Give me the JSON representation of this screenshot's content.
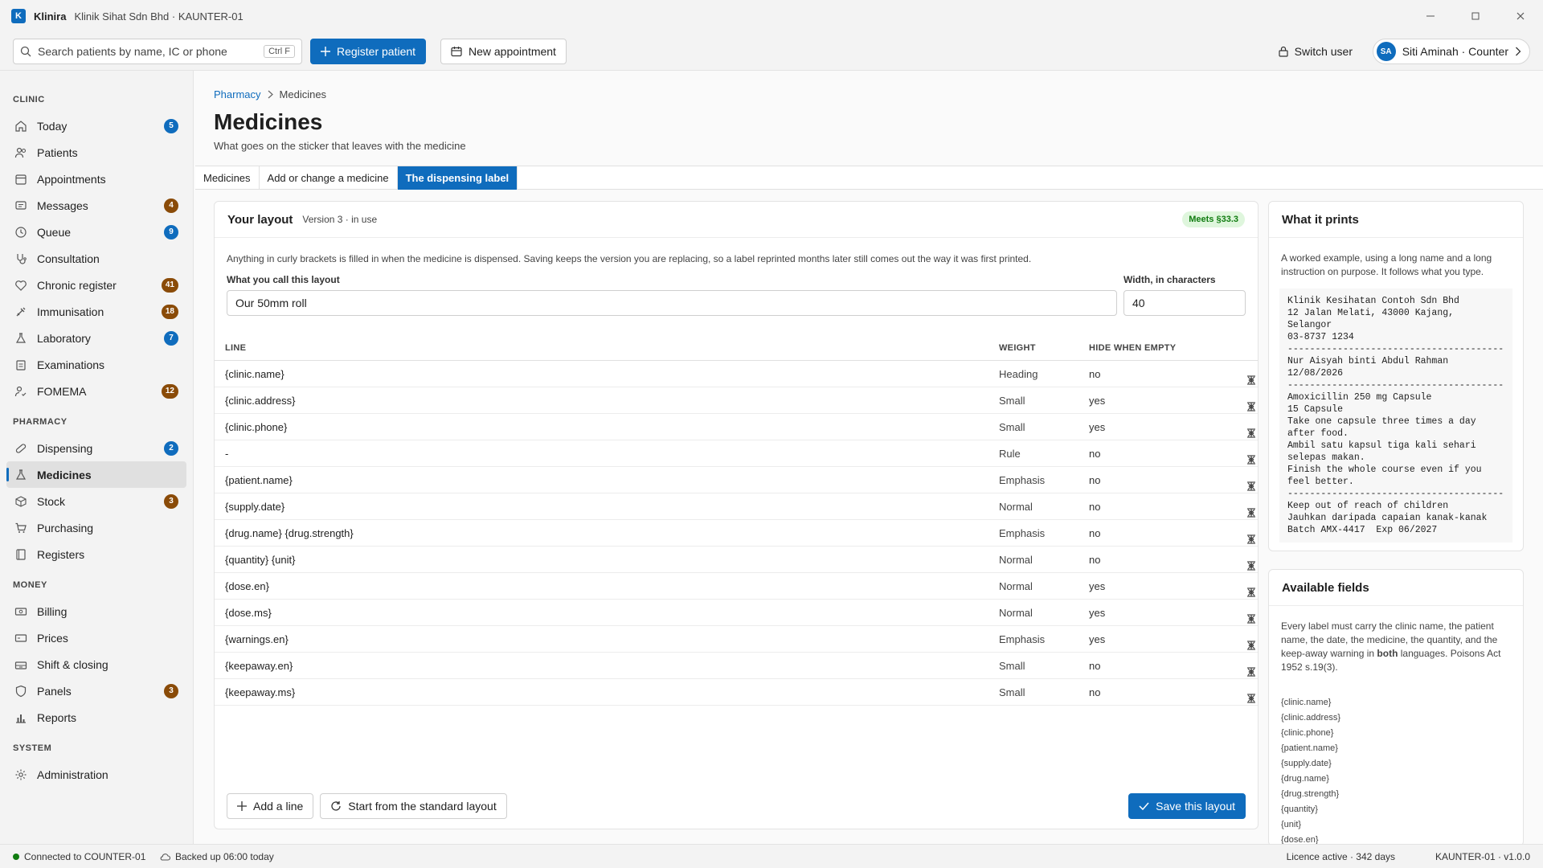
{
  "app": {
    "logo_letter": "K",
    "name": "Klinira",
    "subtitle": "Klinik Sihat Sdn Bhd · KAUNTER-01"
  },
  "toolbar": {
    "search_placeholder": "Search patients by name, IC or phone",
    "search_shortcut": "Ctrl F",
    "register_label": "Register patient",
    "appointment_label": "New appointment",
    "switch_user_label": "Switch user",
    "user_initials": "SA",
    "user_label": "Siti Aminah · Counter"
  },
  "sidebar": {
    "sections": [
      {
        "title": "CLINIC",
        "items": [
          {
            "label": "Today",
            "icon": "home-icon",
            "badge": "5",
            "badge_color": "blue"
          },
          {
            "label": "Patients",
            "icon": "people-icon"
          },
          {
            "label": "Appointments",
            "icon": "calendar-icon"
          },
          {
            "label": "Messages",
            "icon": "message-icon",
            "badge": "4",
            "badge_color": "brown"
          },
          {
            "label": "Queue",
            "icon": "clock-icon",
            "badge": "9",
            "badge_color": "blue"
          },
          {
            "label": "Consultation",
            "icon": "stethoscope-icon"
          },
          {
            "label": "Chronic register",
            "icon": "heart-icon",
            "badge": "41",
            "badge_color": "brown"
          },
          {
            "label": "Immunisation",
            "icon": "syringe-icon",
            "badge": "18",
            "badge_color": "brown"
          },
          {
            "label": "Laboratory",
            "icon": "flask-icon",
            "badge": "7",
            "badge_color": "blue"
          },
          {
            "label": "Examinations",
            "icon": "clipboard-icon"
          },
          {
            "label": "FOMEMA",
            "icon": "person-check-icon",
            "badge": "12",
            "badge_color": "brown"
          }
        ]
      },
      {
        "title": "PHARMACY",
        "items": [
          {
            "label": "Dispensing",
            "icon": "pill-icon",
            "badge": "2",
            "badge_color": "blue"
          },
          {
            "label": "Medicines",
            "icon": "flask-icon",
            "active": true
          },
          {
            "label": "Stock",
            "icon": "box-icon",
            "badge": "3",
            "badge_color": "brown"
          },
          {
            "label": "Purchasing",
            "icon": "cart-icon"
          },
          {
            "label": "Registers",
            "icon": "book-icon"
          }
        ]
      },
      {
        "title": "MONEY",
        "items": [
          {
            "label": "Billing",
            "icon": "money-icon"
          },
          {
            "label": "Prices",
            "icon": "tag-icon"
          },
          {
            "label": "Shift & closing",
            "icon": "cash-drawer-icon"
          },
          {
            "label": "Panels",
            "icon": "shield-icon",
            "badge": "3",
            "badge_color": "brown"
          },
          {
            "label": "Reports",
            "icon": "bar-chart-icon"
          }
        ]
      },
      {
        "title": "SYSTEM",
        "items": [
          {
            "label": "Administration",
            "icon": "gear-icon"
          }
        ]
      }
    ]
  },
  "page": {
    "breadcrumb_parent": "Pharmacy",
    "breadcrumb_current": "Medicines",
    "title": "Medicines",
    "subtitle": "What goes on the sticker that leaves with the medicine",
    "tabs": [
      {
        "label": "Medicines"
      },
      {
        "label": "Add or change a medicine"
      },
      {
        "label": "The dispensing label",
        "active": true
      }
    ]
  },
  "layout_card": {
    "title": "Your layout",
    "version": "Version 3 · in use",
    "badge": "Meets §33.3",
    "intro": "Anything in curly brackets is filled in when the medicine is dispensed. Saving keeps the version you are replacing, so a label reprinted months later still comes out the way it was first printed.",
    "name_label": "What you call this layout",
    "name_value": "Our 50mm roll",
    "width_label": "Width, in characters",
    "width_value": "40",
    "columns": {
      "line": "LINE",
      "weight": "WEIGHT",
      "hide": "HIDE WHEN EMPTY"
    },
    "rows": [
      {
        "line": "{clinic.name}",
        "weight": "Heading",
        "hide": "no"
      },
      {
        "line": "{clinic.address}",
        "weight": "Small",
        "hide": "yes"
      },
      {
        "line": "{clinic.phone}",
        "weight": "Small",
        "hide": "yes"
      },
      {
        "line": "-",
        "weight": "Rule",
        "hide": "no"
      },
      {
        "line": "{patient.name}",
        "weight": "Emphasis",
        "hide": "no"
      },
      {
        "line": "{supply.date}",
        "weight": "Normal",
        "hide": "no"
      },
      {
        "line": "{drug.name} {drug.strength}",
        "weight": "Emphasis",
        "hide": "no"
      },
      {
        "line": "{quantity} {unit}",
        "weight": "Normal",
        "hide": "no"
      },
      {
        "line": "{dose.en}",
        "weight": "Normal",
        "hide": "yes"
      },
      {
        "line": "{dose.ms}",
        "weight": "Normal",
        "hide": "yes"
      },
      {
        "line": "{warnings.en}",
        "weight": "Emphasis",
        "hide": "yes"
      },
      {
        "line": "{keepaway.en}",
        "weight": "Small",
        "hide": "no"
      },
      {
        "line": "{keepaway.ms}",
        "weight": "Small",
        "hide": "no"
      }
    ],
    "add_line_label": "Add a line",
    "standard_label": "Start from the standard layout",
    "save_label": "Save this layout"
  },
  "print_card": {
    "title": "What it prints",
    "intro": "A worked example, using a long name and a long instruction on purpose. It follows what you type.",
    "preview_lines": [
      "Klinik Kesihatan Contoh Sdn Bhd",
      "12 Jalan Melati, 43000 Kajang,",
      "Selangor",
      "03-8737 1234",
      "----------------------------------------",
      "Nur Aisyah binti Abdul Rahman",
      "12/08/2026",
      "----------------------------------------",
      "Amoxicillin 250 mg Capsule",
      "15 Capsule",
      "Take one capsule three times a day",
      "after food.",
      "Ambil satu kapsul tiga kali sehari",
      "selepas makan.",
      "Finish the whole course even if you",
      "feel better.",
      "----------------------------------------",
      "Keep out of reach of children",
      "Jauhkan daripada capaian kanak-kanak",
      "Batch AMX-4417  Exp 06/2027"
    ]
  },
  "fields_card": {
    "title": "Available fields",
    "intro_before": "Every label must carry the clinic name, the patient name, the date, the medicine, the quantity, and the keep-away warning in ",
    "intro_bold": "both",
    "intro_after": " languages. Poisons Act 1952 s.19(3).",
    "fields": [
      "{clinic.name}",
      "{clinic.address}",
      "{clinic.phone}",
      "{patient.name}",
      "{supply.date}",
      "{drug.name}",
      "{drug.strength}",
      "{quantity}",
      "{unit}",
      "{dose.en}"
    ]
  },
  "status": {
    "connection": "Connected to COUNTER-01",
    "backup": "Backed up 06:00 today",
    "licence": "Licence active · 342 days",
    "version": "KAUNTER-01 · v1.0.0"
  }
}
